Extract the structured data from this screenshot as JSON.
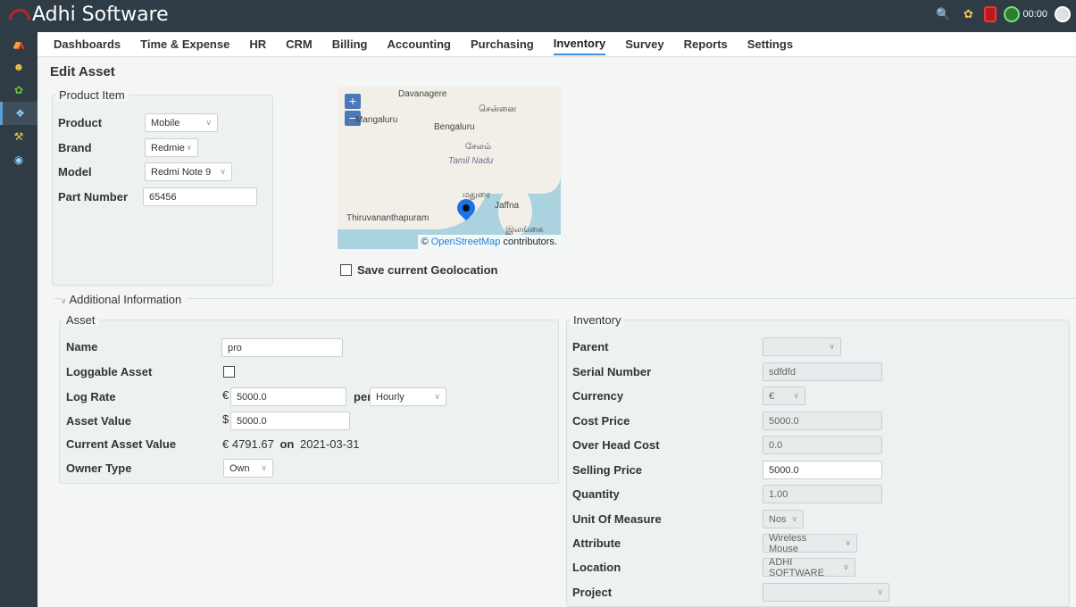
{
  "app": {
    "title": "Adhi Software"
  },
  "topbar": {
    "timer": "00:00"
  },
  "nav": [
    "Dashboards",
    "Time & Expense",
    "HR",
    "CRM",
    "Billing",
    "Accounting",
    "Purchasing",
    "Inventory",
    "Survey",
    "Reports",
    "Settings"
  ],
  "page": {
    "title": "Edit Asset"
  },
  "product": {
    "legend": "Product Item",
    "product_label": "Product",
    "product_value": "Mobile",
    "brand_label": "Brand",
    "brand_value": "Redmie",
    "model_label": "Model",
    "model_value": "Redmi Note 9",
    "part_label": "Part Number",
    "part_value": "65456"
  },
  "map": {
    "zoom_in": "+",
    "zoom_out": "−",
    "places": [
      "Davanagere",
      "Mangaluru",
      "சென்னை",
      "Bengaluru",
      "சேலம்",
      "Tamil Nadu",
      "மதுரை",
      "Jaffna",
      "Thiruvananthapuram",
      "இலங்கை"
    ],
    "attribution_prefix": "©",
    "attribution_link": "OpenStreetMap",
    "attribution_suffix": "contributors.",
    "geo_label": "Save current Geolocation"
  },
  "additional": {
    "title": "Additional Information"
  },
  "asset": {
    "legend": "Asset",
    "name_label": "Name",
    "name_value": "pro",
    "loggable_label": "Loggable Asset",
    "lograte_label": "Log Rate",
    "lograte_currency": "€",
    "lograte_value": "5000.0",
    "per_label": "per",
    "per_value": "Hourly",
    "assetvalue_label": "Asset Value",
    "assetvalue_currency": "$",
    "assetvalue_value": "5000.0",
    "current_label": "Current Asset Value",
    "current_value": "€ 4791.67",
    "on_label": "on",
    "current_date": "2021-03-31",
    "owner_label": "Owner Type",
    "owner_value": "Own"
  },
  "inventory": {
    "legend": "Inventory",
    "parent_label": "Parent",
    "parent_value": "",
    "serial_label": "Serial Number",
    "serial_value": "sdfdfd",
    "currency_label": "Currency",
    "currency_value": "€",
    "cost_label": "Cost Price",
    "cost_value": "5000.0",
    "overhead_label": "Over Head Cost",
    "overhead_value": "0.0",
    "selling_label": "Selling Price",
    "selling_value": "5000.0",
    "qty_label": "Quantity",
    "qty_value": "1.00",
    "uom_label": "Unit Of Measure",
    "uom_value": "Nos",
    "attr_label": "Attribute",
    "attr_value": "Wireless Mouse",
    "location_label": "Location",
    "location_value": "ADHI SOFTWARE",
    "project_label": "Project",
    "project_value": ""
  }
}
